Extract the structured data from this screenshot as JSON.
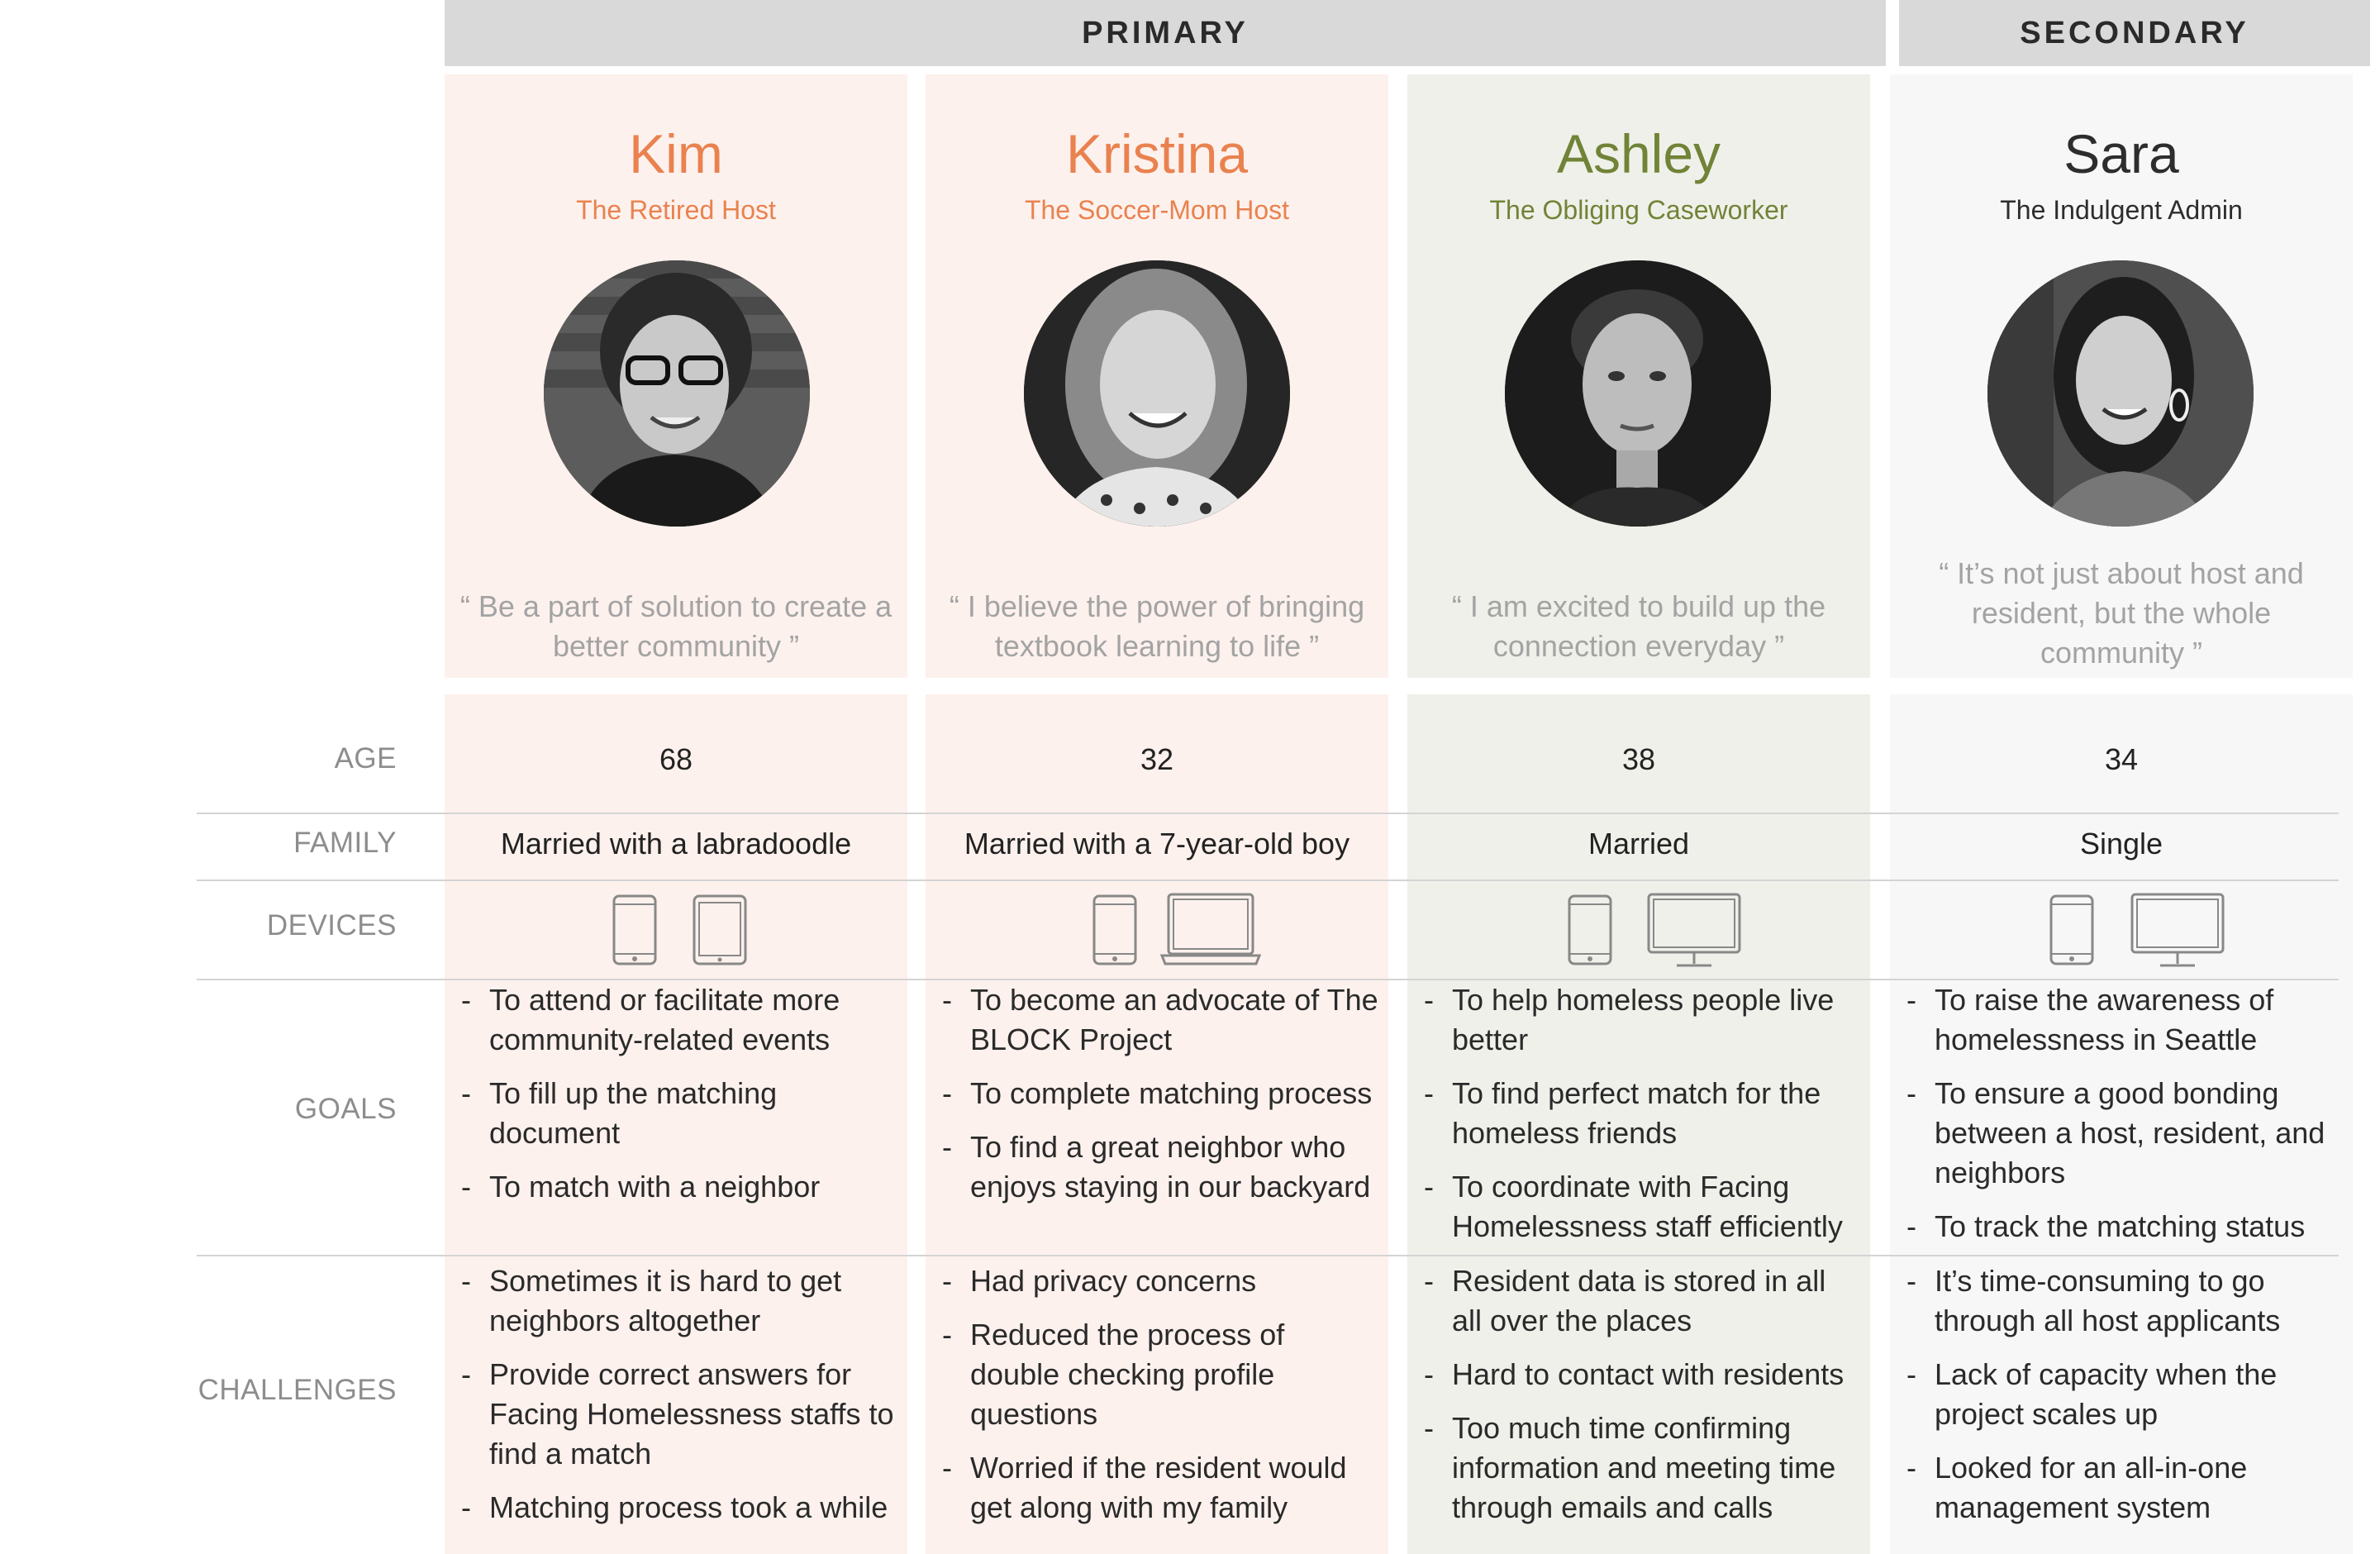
{
  "header": {
    "primary": "PRIMARY",
    "secondary": "SECONDARY"
  },
  "colors": {
    "orange": "#e9824f",
    "green": "#718336",
    "dark": "#2d2d2d",
    "pink_bg": "#fdf1ed",
    "green_bg": "#eff0ea",
    "gray_bg": "#f7f7f7"
  },
  "row_labels": {
    "age": "AGE",
    "family": "FAMILY",
    "devices": "DEVICES",
    "goals": "GOALS",
    "challenges": "CHALLENGES"
  },
  "personas": [
    {
      "name": "Kim",
      "subtitle": "The Retired Host",
      "quote_lines": [
        "“ Be a part of solution to create a",
        "better community ”"
      ],
      "age": "68",
      "family": "Married with a labradoodle",
      "devices": [
        "phone-icon",
        "tablet-icon"
      ],
      "goals": [
        "To attend or facilitate more community-related events",
        "To fill up the matching document",
        "To match with a neighbor"
      ],
      "challenges": [
        "Sometimes it is hard to get neighbors altogether",
        "Provide correct answers for Facing Homelessness staffs to find a match",
        "Matching process took a while"
      ]
    },
    {
      "name": "Kristina",
      "subtitle": "The Soccer-Mom Host",
      "quote_lines": [
        "“ I believe the power of bringing",
        "textbook learning to life ”"
      ],
      "age": "32",
      "family": "Married with a 7-year-old boy",
      "devices": [
        "phone-icon",
        "laptop-icon"
      ],
      "goals": [
        "To become an advocate of The BLOCK Project",
        "To complete matching process",
        "To find a great neighbor who enjoys staying in our backyard"
      ],
      "challenges": [
        "Had privacy concerns",
        "Reduced the process of double checking profile questions",
        "Worried if the resident would get along with my family"
      ]
    },
    {
      "name": "Ashley",
      "subtitle": "The Obliging Caseworker",
      "quote_lines": [
        "“ I am excited to build up the",
        "connection everyday ”"
      ],
      "age": "38",
      "family": "Married",
      "devices": [
        "phone-icon",
        "monitor-icon"
      ],
      "goals": [
        "To help homeless people live better",
        "To find perfect match for the homeless friends",
        "To coordinate with Facing Homelessness staff efficiently"
      ],
      "challenges": [
        "Resident data is stored in all all over the places",
        "Hard to contact with residents",
        "Too much time confirming information and meeting time through emails and calls"
      ]
    },
    {
      "name": "Sara",
      "subtitle": "The Indulgent Admin",
      "quote_lines": [
        "“ It’s not just about host and",
        "resident, but the whole",
        "community ”"
      ],
      "age": "34",
      "family": "Single",
      "devices": [
        "phone-icon",
        "monitor-icon"
      ],
      "goals": [
        "To raise the awareness of homelessness in Seattle",
        "To ensure a good bonding between a host, resident, and neighbors",
        "To track the matching status"
      ],
      "challenges": [
        "It’s time-consuming to go through all host applicants",
        "Lack of capacity when the project scales up",
        "Looked for an all-in-one management system"
      ]
    }
  ]
}
